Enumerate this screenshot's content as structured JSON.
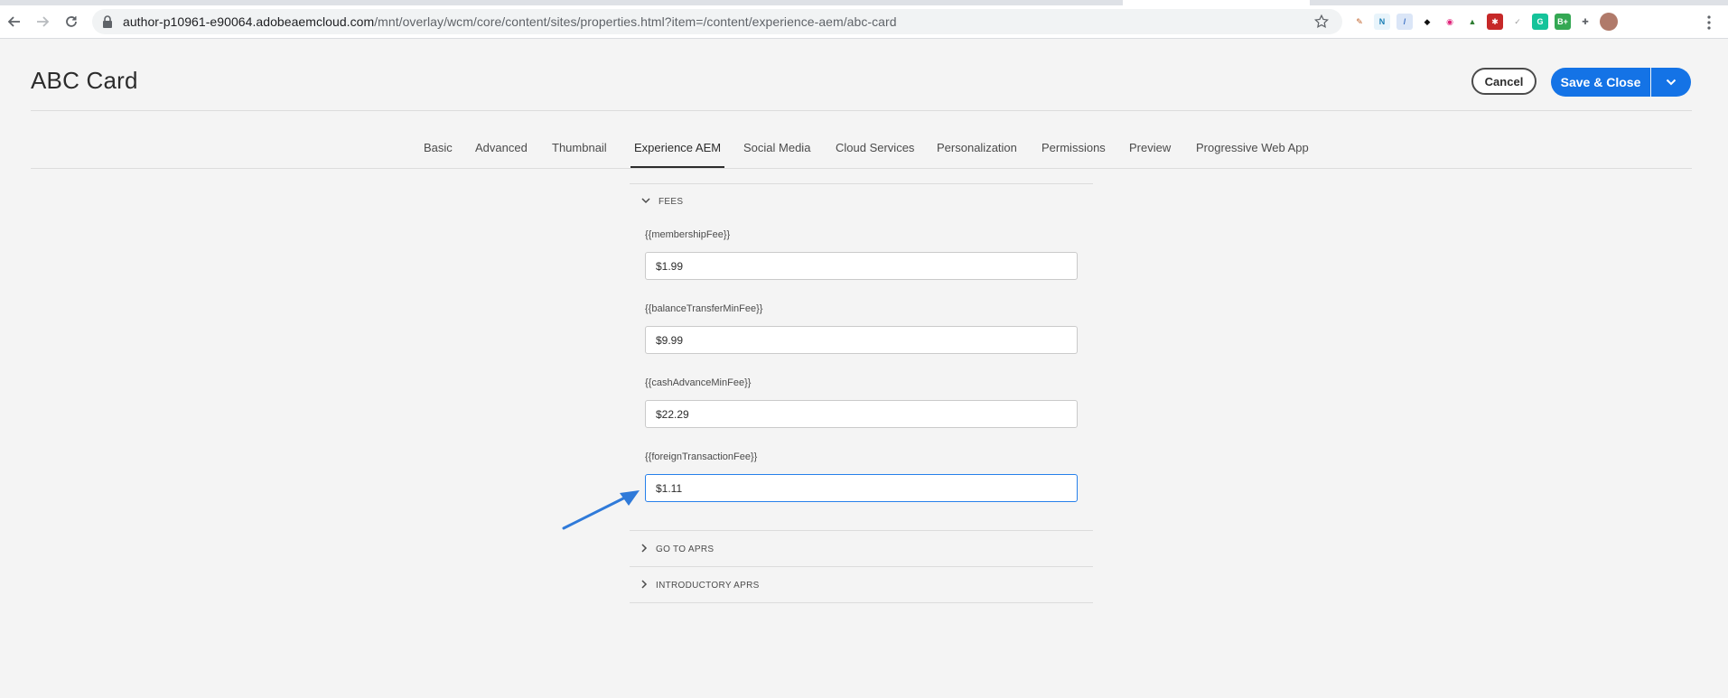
{
  "browser": {
    "url_host": "author-p10961-e90064.adobeaemcloud.com",
    "url_path": "/mnt/overlay/wcm/core/content/sites/properties.html?item=/content/experience-aem/abc-card",
    "extensions": [
      {
        "name": "pen-extension-icon",
        "color": "#ffffff",
        "glyph": "✎",
        "fg": "#c0622b"
      },
      {
        "name": "n-extension-icon",
        "color": "#e8f4fb",
        "glyph": "N",
        "fg": "#1b7fb5"
      },
      {
        "name": "slash-extension-icon",
        "color": "#dbe6f7",
        "glyph": "/",
        "fg": "#3b6fc4"
      },
      {
        "name": "incognito-extension-icon",
        "color": "#ffffff",
        "glyph": "◆",
        "fg": "#111111"
      },
      {
        "name": "eye-extension-icon",
        "color": "#ffffff",
        "glyph": "◉",
        "fg": "#e0237a"
      },
      {
        "name": "triangle-extension-icon",
        "color": "#ffffff",
        "glyph": "▲",
        "fg": "#2e7d32"
      },
      {
        "name": "puzzle-red-extension-icon",
        "color": "#c62828",
        "glyph": "✱",
        "fg": "#ffffff"
      },
      {
        "name": "feather-extension-icon",
        "color": "#ffffff",
        "glyph": "✓",
        "fg": "#9e9e9e"
      },
      {
        "name": "grammarly-extension-icon",
        "color": "#15c39a",
        "glyph": "G",
        "fg": "#ffffff"
      },
      {
        "name": "b-plus-extension-icon",
        "color": "#34a853",
        "glyph": "B+",
        "fg": "#ffffff"
      },
      {
        "name": "puzzle-extension-icon",
        "color": "#ffffff",
        "glyph": "✚",
        "fg": "#5f6368"
      },
      {
        "name": "profile-avatar",
        "color": "#b07a6a",
        "glyph": "",
        "fg": "#ffffff"
      }
    ]
  },
  "page": {
    "title": "ABC Card",
    "cancel_label": "Cancel",
    "save_label": "Save & Close"
  },
  "tabs": [
    {
      "label": "Basic",
      "selected": false
    },
    {
      "label": "Advanced",
      "selected": false
    },
    {
      "label": "Thumbnail",
      "selected": false
    },
    {
      "label": "Experience AEM",
      "selected": true
    },
    {
      "label": "Social Media",
      "selected": false
    },
    {
      "label": "Cloud Services",
      "selected": false
    },
    {
      "label": "Personalization",
      "selected": false
    },
    {
      "label": "Permissions",
      "selected": false
    },
    {
      "label": "Preview",
      "selected": false
    },
    {
      "label": "Progressive Web App",
      "selected": false
    }
  ],
  "accordion": {
    "fees": {
      "title": "FEES",
      "expanded": true,
      "fields": [
        {
          "label": "{{membershipFee}}",
          "value": "$1.99"
        },
        {
          "label": "{{balanceTransferMinFee}}",
          "value": "$9.99"
        },
        {
          "label": "{{cashAdvanceMinFee}}",
          "value": "$22.29"
        },
        {
          "label": "{{foreignTransactionFee}}",
          "value": "$1.11"
        }
      ]
    },
    "go_to_aprs": {
      "title": "GO TO APRS",
      "expanded": false
    },
    "introductory_aprs": {
      "title": "INTRODUCTORY APRS",
      "expanded": false
    }
  },
  "colors": {
    "accent": "#1473e6",
    "focus_border": "#2680eb",
    "annotation_arrow": "#2f7ad9"
  }
}
